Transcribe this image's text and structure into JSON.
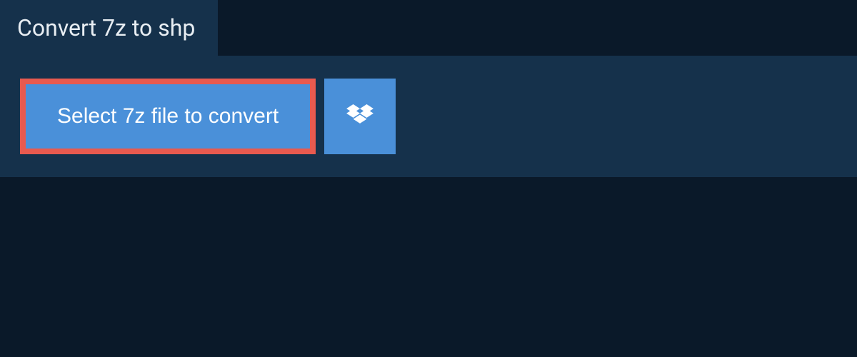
{
  "tab": {
    "title": "Convert 7z to shp"
  },
  "actions": {
    "select_file_label": "Select 7z file to convert"
  },
  "colors": {
    "background": "#0a1929",
    "panel": "#15314b",
    "button": "#4a90d9",
    "highlight_border": "#e85a4f",
    "text_light": "#ffffff"
  }
}
